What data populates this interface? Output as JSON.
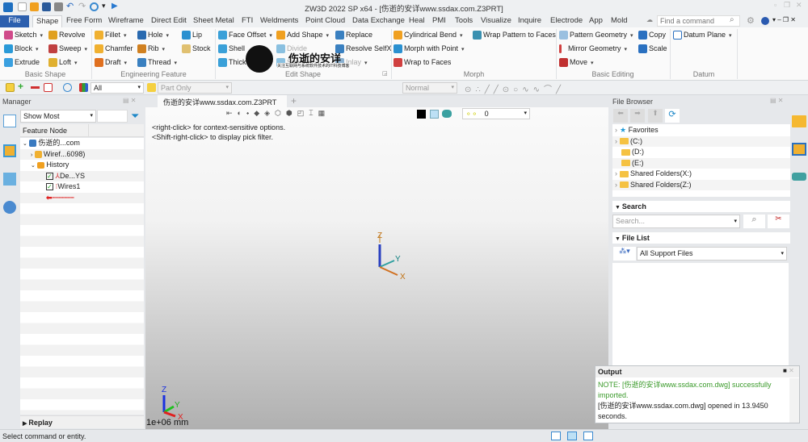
{
  "window": {
    "title": "ZW3D 2022 SP x64 - [伤逝的安详www.ssdax.com.Z3PRT]"
  },
  "menu_tabs": [
    "File",
    "Shape",
    "Free Form",
    "Wireframe",
    "Direct Edit",
    "Sheet Metal",
    "FTI",
    "Weldments",
    "Point Cloud",
    "Data Exchange",
    "Heal",
    "PMI",
    "Tools",
    "Visualize",
    "Inquire",
    "Electrode",
    "App",
    "Mold"
  ],
  "search": {
    "placeholder": "Find a command"
  },
  "ribbon": {
    "basic_shape": {
      "label": "Basic Shape",
      "items": [
        "Sketch",
        "Block",
        "Extrude",
        "Revolve",
        "Sweep",
        "Loft"
      ]
    },
    "engineering_feature": {
      "label": "Engineering Feature",
      "items": [
        "Fillet",
        "Chamfer",
        "Draft",
        "Hole",
        "Rib",
        "Thread",
        "Lip",
        "Stock"
      ]
    },
    "edit_shape": {
      "label": "Edit Shape",
      "items": [
        "Face Offset",
        "Shell",
        "Thick",
        "Add Shape",
        "Divide",
        "Simplify",
        "Replace",
        "Resolve SelfX",
        "Inlay"
      ]
    },
    "morph": {
      "label": "Morph",
      "items": [
        "Cylindrical Bend",
        "Morph with Point",
        "Wrap to Faces",
        "Wrap Pattern to Faces"
      ]
    },
    "basic_editing": {
      "label": "Basic Editing",
      "items": [
        "Pattern Geometry",
        "Mirror Geometry",
        "Move",
        "Copy",
        "Scale"
      ]
    },
    "datum": {
      "label": "Datum",
      "items": [
        "Datum Plane"
      ]
    }
  },
  "watermark": {
    "title": "伤逝的安详",
    "subtitle": "关注互联网与系统软件技术的IT科技博客"
  },
  "toolbar": {
    "filter": "All",
    "scope": "Part Only",
    "style": "Normal",
    "layer": "0"
  },
  "manager": {
    "title": "Manager",
    "show": "Show Most",
    "column": "Feature Node",
    "tree": [
      "伤逝的...com",
      "Wiref...6098)",
      "History",
      "De...YS",
      "Wires1"
    ],
    "replay": "Replay"
  },
  "viewport": {
    "tab": "伤逝的安详www.ssdax.com.Z3PRT",
    "hint1": "<right-click> for context-sensitive options.",
    "hint2": "<Shift-right-click> to display pick filter.",
    "scale": "1e+06 mm",
    "axes": {
      "x": "X",
      "y": "Y",
      "z": "Z"
    }
  },
  "file_browser": {
    "title": "File Browser",
    "items": [
      "Favorites",
      "(C:)",
      "(D:)",
      "(E:)",
      "Shared Folders(X:)",
      "Shared Folders(Z:)"
    ],
    "search_label": "Search",
    "search_placeholder": "Search...",
    "file_list_label": "File List",
    "file_filter": "All Support Files"
  },
  "output": {
    "title": "Output",
    "line1": "NOTE: [伤逝的安详www.ssdax.com.dwg] successfully imported.",
    "line2": "[伤逝的安详www.ssdax.com.dwg] opened in 13.9450 seconds."
  },
  "status": {
    "text": "Select command or entity."
  },
  "colors": {
    "file_tab": "#2c5fae",
    "note_green": "#3a9a2a",
    "accent": "#1e88c8"
  }
}
